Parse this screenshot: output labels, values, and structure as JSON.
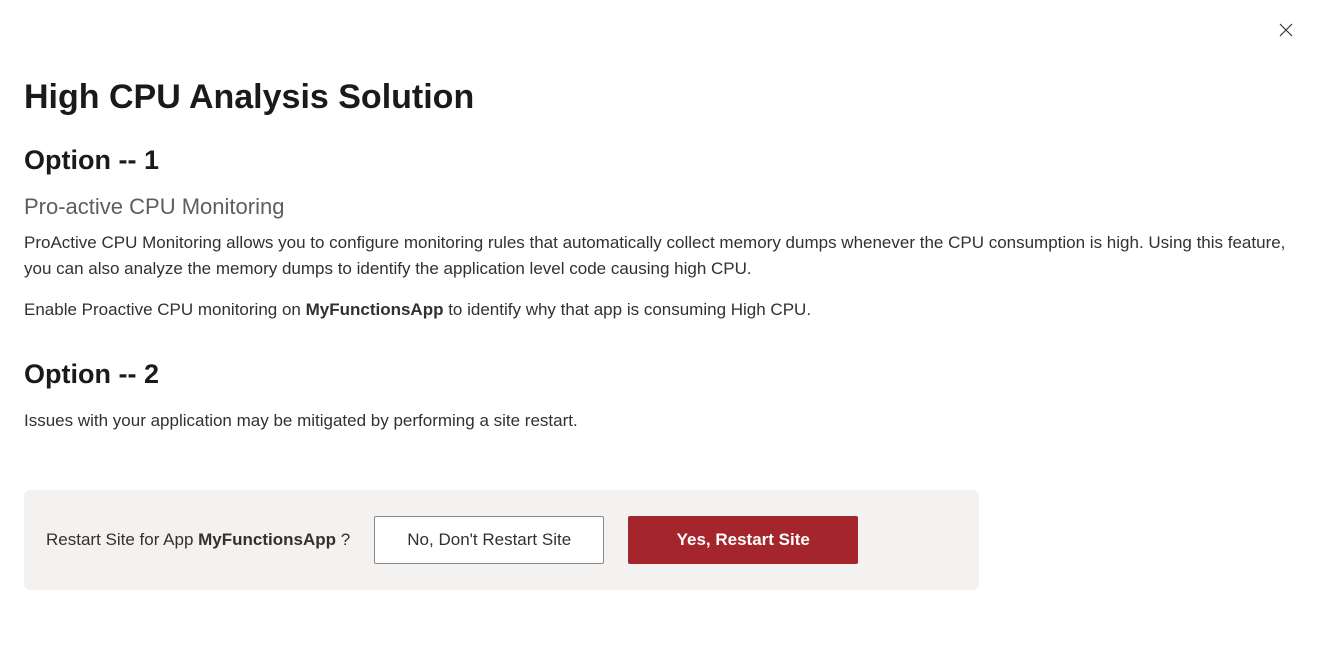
{
  "page_title": "High CPU Analysis Solution",
  "app_name": "MyFunctionsApp",
  "option1": {
    "heading": "Option -- 1",
    "subheading": "Pro-active CPU Monitoring",
    "description": "ProActive CPU Monitoring allows you to configure monitoring rules that automatically collect memory dumps whenever the CPU consumption is high. Using this feature, you can also analyze the memory dumps to identify the application level code causing high CPU.",
    "enable_prefix": "Enable Proactive CPU monitoring on ",
    "enable_suffix": " to identify why that app is consuming High CPU."
  },
  "option2": {
    "heading": "Option -- 2",
    "description": "Issues with your application may be mitigated by performing a site restart."
  },
  "restart_panel": {
    "prompt_prefix": "Restart Site for App ",
    "prompt_suffix": " ?",
    "no_label": "No, Don't Restart Site",
    "yes_label": "Yes, Restart Site"
  }
}
